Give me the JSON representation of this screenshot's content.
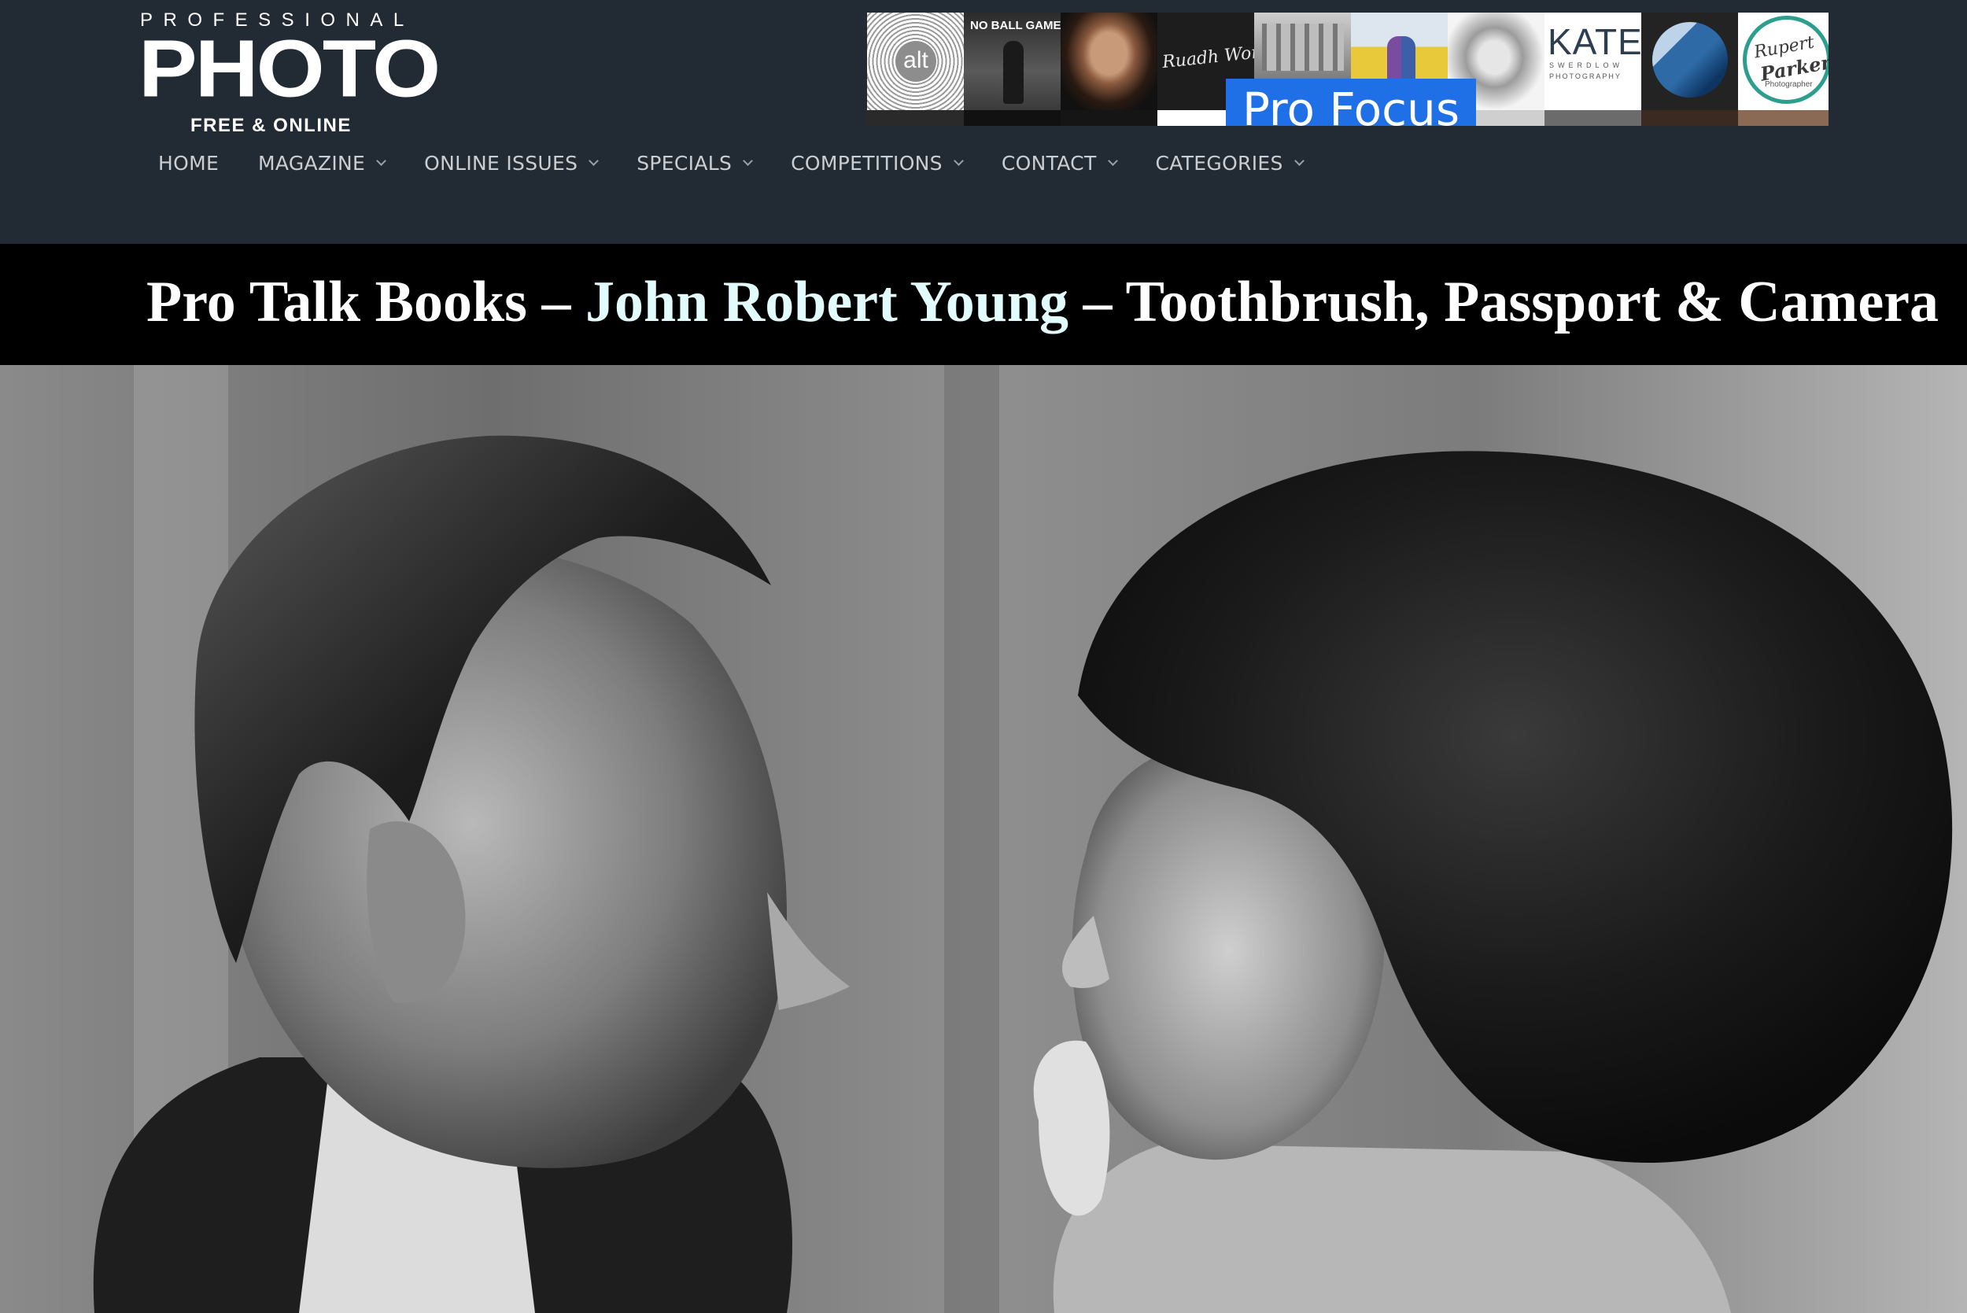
{
  "logo": {
    "top": "PROFESSIONAL",
    "main": "PHOTO",
    "sub": "FREE & ONLINE"
  },
  "sponsors": {
    "tiles": [
      {
        "name": "alt",
        "label": "alt"
      },
      {
        "name": "no-ball-games",
        "label": "NO BALL GAMES"
      },
      {
        "name": "portrait-man"
      },
      {
        "name": "signature",
        "label": "Ruadh Word"
      },
      {
        "name": "building"
      },
      {
        "name": "field-couple"
      },
      {
        "name": "bald-man"
      },
      {
        "name": "kate-swerdlow",
        "label": "KATE",
        "sub1": "SWERDLOW",
        "sub2": "PHOTOGRAPHY"
      },
      {
        "name": "blue-sphere"
      },
      {
        "name": "rupert-parker",
        "label1": "Rupert",
        "label2": "Parker",
        "label3": "Photographer"
      }
    ],
    "badge": "Pro Focus"
  },
  "nav": {
    "items": [
      {
        "label": "HOME",
        "has_dropdown": false
      },
      {
        "label": "MAGAZINE",
        "has_dropdown": true
      },
      {
        "label": "ONLINE ISSUES",
        "has_dropdown": true
      },
      {
        "label": "SPECIALS",
        "has_dropdown": true
      },
      {
        "label": "COMPETITIONS",
        "has_dropdown": true
      },
      {
        "label": "CONTACT",
        "has_dropdown": true
      },
      {
        "label": "CATEGORIES",
        "has_dropdown": true
      }
    ]
  },
  "article": {
    "title_prefix": "Pro Talk Books – ",
    "title_author": "John Robert Young",
    "title_suffix": " – Toothbrush, Passport & Camera"
  },
  "colors": {
    "header_bg": "#222a33",
    "nav_text": "#c9ced4",
    "title_bar_bg": "#000000",
    "title_text": "#ffffff",
    "author_link": "#e2fbfd",
    "badge_bg": "#1f6fe6"
  }
}
